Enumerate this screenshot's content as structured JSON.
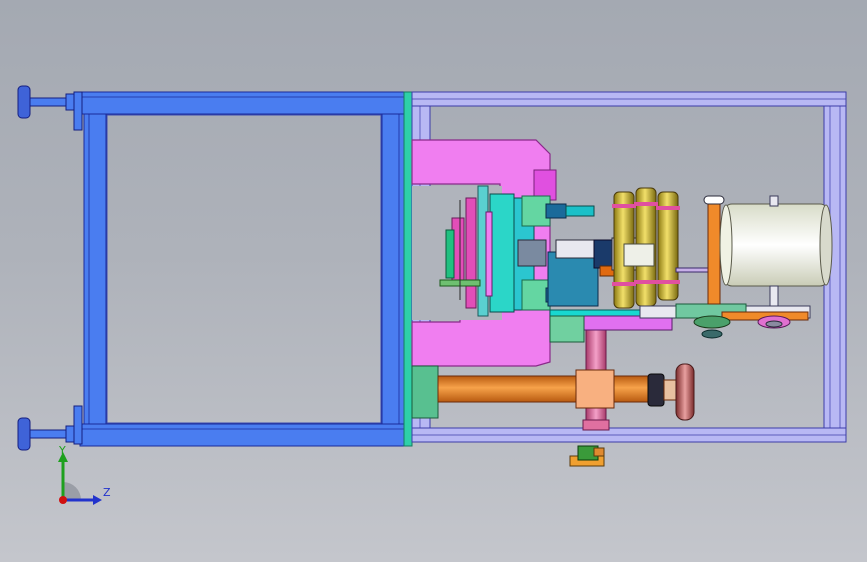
{
  "viewport": {
    "background_top": "#a4a9b2",
    "background_bottom": "#c4c6cc"
  },
  "triad": {
    "y_label": "Y",
    "z_label": "Z",
    "y_color": "#1ea01e",
    "z_color": "#2233cc",
    "origin_color": "#d01010"
  },
  "colors": {
    "frame_blue": "#4a7df0",
    "frame_edge": "#1a2a9a",
    "rail_lavender": "#b8b8f4",
    "magenta_block": "#f07ef0",
    "teal": "#2bd6c8",
    "gold": "#d4c23a",
    "orange": "#f08a2a",
    "pink": "#f078a8",
    "drum": "#f8fbea",
    "green": "#6ed49a",
    "cyan_bar": "#18d8d0"
  },
  "model_parts": [
    "frame-left",
    "frame-right",
    "leveling-foot-top",
    "leveling-foot-bottom",
    "press-block",
    "platen",
    "coil-spring-stack",
    "spool-drum",
    "lead-screw",
    "handwheel",
    "vertical-post",
    "base-plate"
  ]
}
